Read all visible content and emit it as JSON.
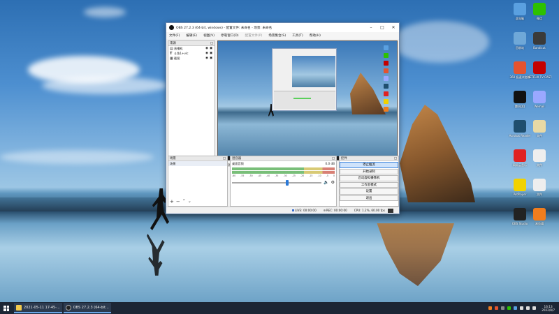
{
  "window": {
    "title": "OBS 27.2.3 (64-bit, windows) - 配置文件: 未命名 - 场景: 未命名"
  },
  "menu": [
    "文件(F)",
    "编辑(E)",
    "视图(V)",
    "停靠窗口(D)",
    "配置文件(P)",
    "场景集合(S)",
    "工具(T)",
    "帮助(H)"
  ],
  "sources": {
    "header": "来源",
    "items": [
      {
        "name": "直播机",
        "icon": "monitor-icon"
      },
      {
        "name": "斗鱼1+vlc",
        "icon": "text-icon"
      },
      {
        "name": "截图",
        "icon": "image-icon"
      }
    ]
  },
  "scene_bar": {
    "label": "未选择源"
  },
  "scenes": {
    "header": "场景",
    "items": [
      "场景"
    ]
  },
  "mixer": {
    "header": "混音器",
    "channel": "桌面音频",
    "level": "0.0 dB",
    "scale": [
      "-60",
      "-55",
      "-50",
      "-45",
      "-40",
      "-35",
      "-30",
      "-25",
      "-20",
      "-15",
      "-10",
      "-5",
      "0"
    ],
    "volume": 0.6
  },
  "controls": {
    "header": "控件",
    "buttons": [
      "停止推流",
      "开始录制",
      "启动虚拟摄像机",
      "工作室模式",
      "设置",
      "退出"
    ]
  },
  "status": {
    "live_label": "LIVE:",
    "live_time": "00:00:00",
    "rec_label": "REC:",
    "rec_time": "00:00:00",
    "cpu": "CPU: 1.2%, 60.00 fps"
  },
  "desktop_icons": [
    {
      "label": "此电脑",
      "color": "#5aa0e0"
    },
    {
      "label": "微信",
      "color": "#2dc100"
    },
    {
      "label": "回收站",
      "color": "#6fa8d8"
    },
    {
      "label": "Bandicut",
      "color": "#3a3a3a"
    },
    {
      "label": "360 极速浏览器",
      "color": "#e4532f"
    },
    {
      "label": "NETFLIX TV CAST",
      "color": "#c40000"
    },
    {
      "label": "腾讯QQ",
      "color": "#111111"
    },
    {
      "label": "Wemail",
      "color": "#9aa8ff"
    },
    {
      "label": "Acrobat Reader",
      "color": "#1f4e6e"
    },
    {
      "label": "文件",
      "color": "#e8d9a5"
    },
    {
      "label": "网易云音乐",
      "color": "#e02222"
    },
    {
      "label": "文件",
      "color": "#eeeeee"
    },
    {
      "label": "PotPlayer",
      "color": "#f2d200"
    },
    {
      "label": "文件",
      "color": "#eeeeee"
    },
    {
      "label": "OBS Studio",
      "color": "#222222"
    },
    {
      "label": "易剪辑",
      "color": "#f07d1e"
    }
  ],
  "taskbar": {
    "items": [
      {
        "label": "2021-05-11 17-45-...",
        "icon": "folder-icon"
      },
      {
        "label": "OBS 27.2.3 (64-bit...",
        "icon": "obs-icon"
      }
    ],
    "time": "16:13",
    "date": "2022/8/7"
  }
}
